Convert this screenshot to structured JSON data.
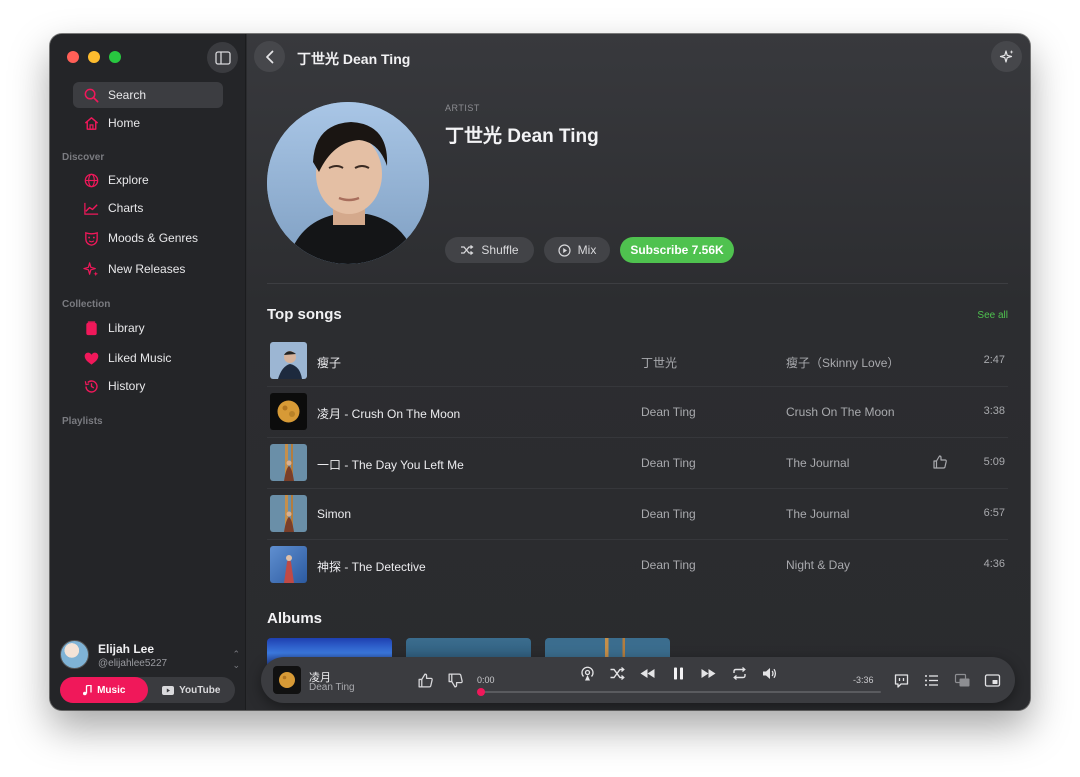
{
  "sidebar": {
    "search_label": "Search",
    "home_label": "Home",
    "discover_label": "Discover",
    "explore_label": "Explore",
    "charts_label": "Charts",
    "moods_label": "Moods & Genres",
    "new_releases_label": "New Releases",
    "collection_label": "Collection",
    "library_label": "Library",
    "liked_label": "Liked Music",
    "history_label": "History",
    "playlists_label": "Playlists",
    "user": {
      "name": "Elijah Lee",
      "handle": "@elijahlee5227"
    },
    "source": {
      "music": "Music",
      "youtube": "YouTube",
      "selected": "Music"
    }
  },
  "topbar": {
    "title": "丁世光 Dean Ting"
  },
  "artist": {
    "kind": "ARTIST",
    "name": "丁世光 Dean Ting",
    "shuffle_label": "Shuffle",
    "mix_label": "Mix",
    "subscribe_label": "Subscribe 7.56K"
  },
  "top_songs": {
    "title": "Top songs",
    "see_all": "See all",
    "rows": [
      {
        "title": "瘦子",
        "artist": "丁世光",
        "album": "瘦子（Skinny Love）",
        "duration": "2:47",
        "liked": false
      },
      {
        "title": "凌月 - Crush On The Moon",
        "artist": "Dean Ting",
        "album": "Crush On The Moon",
        "duration": "3:38",
        "liked": false
      },
      {
        "title": "一口 - The Day You Left Me",
        "artist": "Dean Ting",
        "album": "The Journal",
        "duration": "5:09",
        "liked": true
      },
      {
        "title": "Simon",
        "artist": "Dean Ting",
        "album": "The Journal",
        "duration": "6:57",
        "liked": false
      },
      {
        "title": "神探 - The Detective",
        "artist": "Dean Ting",
        "album": "Night & Day",
        "duration": "4:36",
        "liked": false
      }
    ]
  },
  "albums": {
    "title": "Albums"
  },
  "player": {
    "title": "凌月",
    "artist": "Dean Ting",
    "elapsed": "0:00",
    "remaining": "-3:36",
    "progress": 0
  },
  "colors": {
    "accent": "#f0185a",
    "subscribe": "#4fc24f"
  }
}
